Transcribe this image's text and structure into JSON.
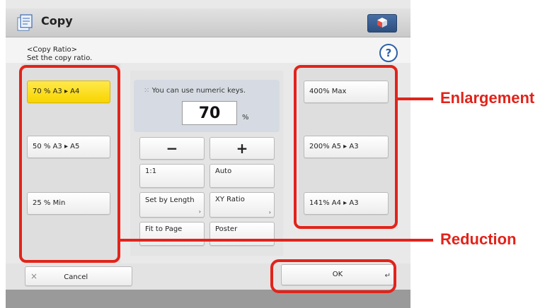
{
  "window": {
    "title": "Copy"
  },
  "header": {
    "section": "<Copy Ratio>",
    "instruction": "Set the copy ratio."
  },
  "help": {
    "label": "?"
  },
  "reduction": {
    "items": [
      {
        "label": "70 % A3 ▸ A4",
        "selected": true
      },
      {
        "label": "50 % A3 ▸ A5",
        "selected": false
      },
      {
        "label": "25 % Min",
        "selected": false
      }
    ]
  },
  "numeric": {
    "hint": "You can use numeric keys.",
    "value": "70",
    "unit": "%"
  },
  "controls": {
    "minus": "−",
    "plus": "+",
    "one_to_one": "1:1",
    "auto": "Auto",
    "set_by_length": "Set by Length",
    "xy_ratio": "XY Ratio",
    "fit_to_page": "Fit to Page",
    "poster": "Poster",
    "submenu_arrow": "›"
  },
  "enlargement": {
    "items": [
      {
        "label": "400% Max"
      },
      {
        "label": "200% A5 ▸ A3"
      },
      {
        "label": "141% A4 ▸ A3"
      }
    ]
  },
  "footer": {
    "cancel": "Cancel",
    "cancel_icon": "×",
    "ok": "OK",
    "ok_icon": "↵"
  },
  "annotations": {
    "enlargement": "Enlargement",
    "reduction": "Reduction"
  },
  "colors": {
    "selected": "#f8d400",
    "annotation": "#e2231a",
    "home_button": "#2d4f80",
    "help": "#2d5fa8"
  }
}
